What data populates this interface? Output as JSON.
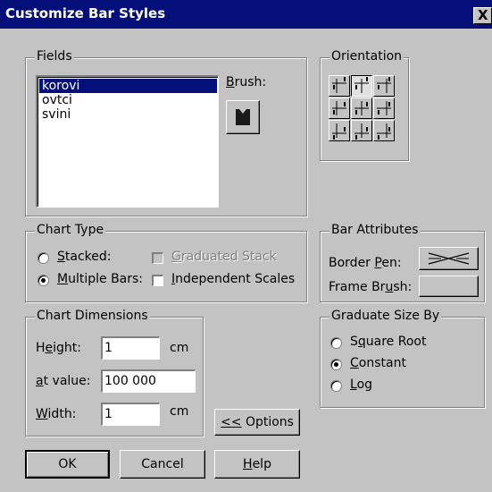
{
  "window": {
    "title": "Customize Bar Styles",
    "close_glyph": "X"
  },
  "fields": {
    "group_label": "Fields",
    "items": [
      "korovi",
      "ovtci",
      "svini"
    ],
    "selected": "korovi",
    "brush_label_prefix": "",
    "brush_label_u": "B",
    "brush_label_rest": "rush:"
  },
  "orientation": {
    "group_label": "Orientation",
    "pressed_index": 1
  },
  "chart_type": {
    "group_label": "Chart Type",
    "stacked": {
      "u": "S",
      "rest": "tacked:",
      "checked": false
    },
    "multiple_bars": {
      "u": "M",
      "rest": "ultiple Bars:",
      "checked": true
    },
    "graduated_stack": {
      "u": "G",
      "rest": "raduated Stack",
      "enabled": false
    },
    "independent_scales": {
      "u": "I",
      "rest": "ndependent Scales",
      "checked": false
    }
  },
  "bar_attributes": {
    "group_label": "Bar Attributes",
    "border_pen": {
      "pre": "Border ",
      "u": "P",
      "rest": "en:"
    },
    "frame_brush": {
      "pre": "Frame Br",
      "u": "u",
      "rest": "sh:"
    }
  },
  "chart_dimensions": {
    "group_label": "Chart Dimensions",
    "height": {
      "pre": "H",
      "u": "e",
      "rest": "ight:",
      "value": "1",
      "unit": "cm"
    },
    "at_value": {
      "pre": "",
      "u": "a",
      "rest": "t value:",
      "value": "100 000"
    },
    "width": {
      "pre": "",
      "u": "W",
      "rest": "idth:",
      "value": "1",
      "unit": "cm"
    }
  },
  "graduate": {
    "group_label": "Graduate Size By",
    "square_root": {
      "pre": "S",
      "u": "q",
      "rest": "uare Root",
      "checked": false
    },
    "constant": {
      "pre": "",
      "u": "C",
      "rest": "onstant",
      "checked": true
    },
    "log": {
      "pre": "",
      "u": "L",
      "rest": "og",
      "checked": false
    }
  },
  "buttons": {
    "options": {
      "u": "<<",
      "rest": " Options"
    },
    "ok": "OK",
    "cancel": "Cancel",
    "help": {
      "u": "H",
      "rest": "elp"
    }
  },
  "colors": {
    "title_bar": "#050f7a",
    "face": "#c3c3c3",
    "selection": "#050f7a",
    "brush_swatch": "#1a1a1a"
  }
}
